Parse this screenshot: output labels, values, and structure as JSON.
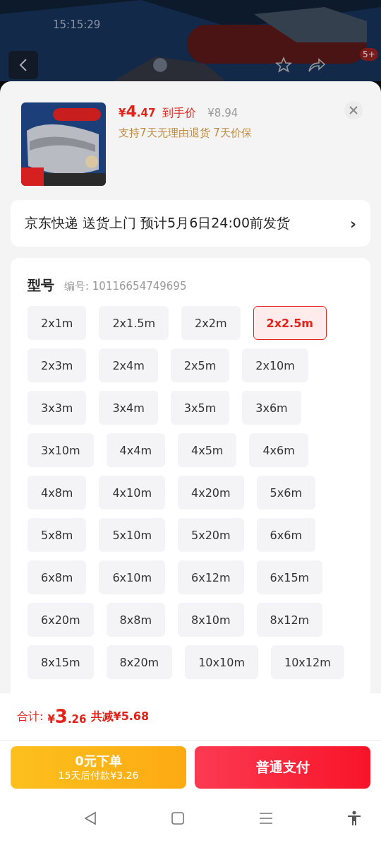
{
  "status_bar": {
    "time": "15:15:29"
  },
  "top_bar": {
    "badge": "5+"
  },
  "product": {
    "price_symbol": "¥",
    "price_int": "4",
    "price_dec": ".47",
    "price_label": "到手价",
    "original_price": "¥8.94",
    "services": "支持7天无理由退货  7天价保"
  },
  "delivery": {
    "text": "京东快递 送货上门 预计5月6日24:00前发货",
    "arrow": "›"
  },
  "options": {
    "title": "型号",
    "code": "编号: 10116654749695",
    "items": [
      {
        "label": "2x1m",
        "selected": false
      },
      {
        "label": "2x1.5m",
        "selected": false
      },
      {
        "label": "2x2m",
        "selected": false
      },
      {
        "label": "2x2.5m",
        "selected": true
      },
      {
        "label": "2x3m",
        "selected": false
      },
      {
        "label": "2x4m",
        "selected": false
      },
      {
        "label": "2x5m",
        "selected": false
      },
      {
        "label": "2x10m",
        "selected": false
      },
      {
        "label": "3x3m",
        "selected": false
      },
      {
        "label": "3x4m",
        "selected": false
      },
      {
        "label": "3x5m",
        "selected": false
      },
      {
        "label": "3x6m",
        "selected": false
      },
      {
        "label": "3x10m",
        "selected": false
      },
      {
        "label": "4x4m",
        "selected": false
      },
      {
        "label": "4x5m",
        "selected": false
      },
      {
        "label": "4x6m",
        "selected": false
      },
      {
        "label": "4x8m",
        "selected": false
      },
      {
        "label": "4x10m",
        "selected": false
      },
      {
        "label": "4x20m",
        "selected": false
      },
      {
        "label": "5x6m",
        "selected": false
      },
      {
        "label": "5x8m",
        "selected": false
      },
      {
        "label": "5x10m",
        "selected": false
      },
      {
        "label": "5x20m",
        "selected": false
      },
      {
        "label": "6x6m",
        "selected": false
      },
      {
        "label": "6x8m",
        "selected": false
      },
      {
        "label": "6x10m",
        "selected": false
      },
      {
        "label": "6x12m",
        "selected": false
      },
      {
        "label": "6x15m",
        "selected": false
      },
      {
        "label": "6x20m",
        "selected": false
      },
      {
        "label": "8x8m",
        "selected": false
      },
      {
        "label": "8x10m",
        "selected": false
      },
      {
        "label": "8x12m",
        "selected": false
      },
      {
        "label": "8x15m",
        "selected": false
      },
      {
        "label": "8x20m",
        "selected": false
      },
      {
        "label": "10x10m",
        "selected": false
      },
      {
        "label": "10x12m",
        "selected": false
      }
    ]
  },
  "total": {
    "label": "合计:",
    "symbol": "¥",
    "int": "3",
    "dec": ".26",
    "discount": "共减¥5.68"
  },
  "buttons": [
    {
      "kind": "later",
      "title": "0元下单",
      "subtitle": "15天后付款¥3.26"
    },
    {
      "kind": "pay",
      "title": "普通支付"
    }
  ]
}
